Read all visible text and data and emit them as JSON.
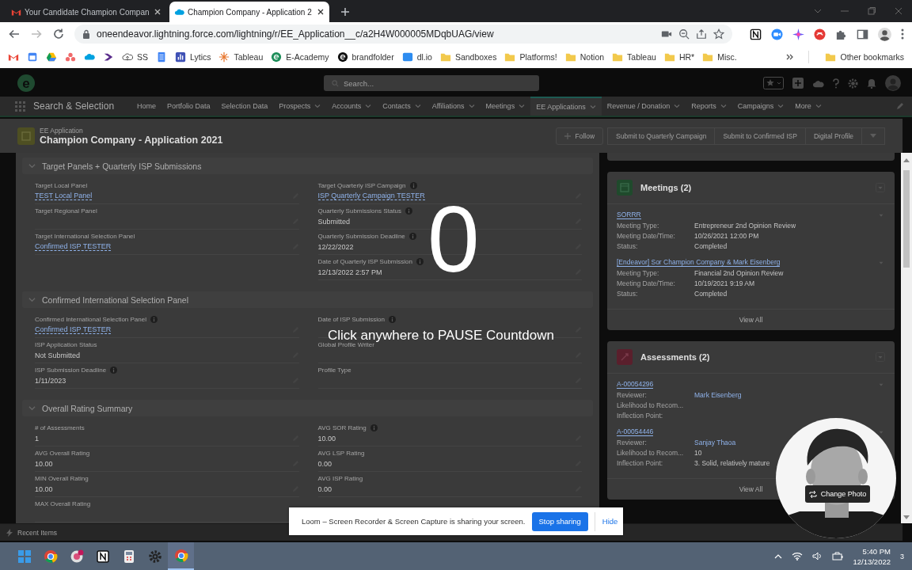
{
  "browser": {
    "tabs": [
      {
        "kind": "mail",
        "title": "Your Candidate Champion Compan",
        "selected": false
      },
      {
        "kind": "cloud",
        "title": "Champion Company - Application 2",
        "selected": true
      }
    ],
    "url": "oneendeavor.lightning.force.com/lightning/r/EE_Application__c/a2H4W000005MDqbUAG/view",
    "bookmarks": [
      {
        "kind": "mail"
      },
      {
        "kind": "calendar"
      },
      {
        "kind": "drive"
      },
      {
        "kind": "dots"
      },
      {
        "kind": "cloud"
      },
      {
        "kind": "chevron"
      },
      {
        "kind": "upload",
        "label": "SS"
      },
      {
        "kind": "doc"
      },
      {
        "kind": "chart",
        "label": "Lytics"
      },
      {
        "kind": "tableau",
        "label": "Tableau"
      },
      {
        "kind": "ecircle",
        "label": "E-Academy"
      },
      {
        "kind": "darkcircle",
        "label": "brandfolder"
      },
      {
        "kind": "square",
        "label": "dl.io"
      },
      {
        "kind": "folder",
        "label": "Sandboxes"
      },
      {
        "kind": "folder",
        "label": "Platforms!"
      },
      {
        "kind": "folder",
        "label": "Notion"
      },
      {
        "kind": "folder",
        "label": "Tableau"
      },
      {
        "kind": "folder",
        "label": "HR*"
      },
      {
        "kind": "folder",
        "label": "Misc."
      }
    ],
    "other_bookmarks": "Other bookmarks"
  },
  "app": {
    "logo_text": "e",
    "search": {
      "placeholder": "Search..."
    },
    "name": "Search & Selection",
    "nav": [
      {
        "label": "Home",
        "dropdown": false,
        "selected": false
      },
      {
        "label": "Portfolio Data",
        "dropdown": false,
        "selected": false
      },
      {
        "label": "Selection Data",
        "dropdown": false,
        "selected": false
      },
      {
        "label": "Prospects",
        "dropdown": true,
        "selected": false
      },
      {
        "label": "Accounts",
        "dropdown": true,
        "selected": false
      },
      {
        "label": "Contacts",
        "dropdown": true,
        "selected": false
      },
      {
        "label": "Affiliations",
        "dropdown": true,
        "selected": false
      },
      {
        "label": "Meetings",
        "dropdown": true,
        "selected": false
      },
      {
        "label": "EE Applications",
        "dropdown": true,
        "selected": true
      },
      {
        "label": "Revenue / Donation",
        "dropdown": true,
        "selected": false
      },
      {
        "label": "Reports",
        "dropdown": true,
        "selected": false
      },
      {
        "label": "Campaigns",
        "dropdown": true,
        "selected": false
      },
      {
        "label": "More",
        "dropdown": true,
        "selected": false
      }
    ]
  },
  "record": {
    "object": "EE Application",
    "title": "Champion Company - Application 2021",
    "actions": [
      {
        "kind": "follow",
        "label": "Follow"
      },
      {
        "kind": "plain",
        "label": "Submit to Quarterly Campaign"
      },
      {
        "kind": "plain",
        "label": "Submit to Confirmed ISP"
      },
      {
        "kind": "plain",
        "label": "Digital Profile"
      },
      {
        "kind": "menu"
      }
    ]
  },
  "sections": [
    {
      "title": "Target Panels + Quarterly ISP Submissions",
      "expanded": true,
      "left": [
        {
          "label": "Target Local Panel",
          "value": "TEST Local Panel",
          "link": true,
          "info": false
        },
        {
          "label": "Target Regional Panel",
          "info": false
        },
        {
          "label": "Target International Selection Panel",
          "value": "Confirmed ISP TESTER",
          "link": true,
          "info": false
        }
      ],
      "right": [
        {
          "label": "Target Quarterly ISP Campaign",
          "value": "ISP Quarterly Campaign TESTER",
          "link": true,
          "info": true
        },
        {
          "label": "Quarterly Submissions Status",
          "value": "Submitted",
          "link": false,
          "info": true
        },
        {
          "label": "Quarterly Submission Deadline",
          "value": "12/22/2022",
          "link": false,
          "info": true
        },
        {
          "label": "Date of Quarterly ISP Submission",
          "value": "12/13/2022 2:57 PM",
          "link": false,
          "info": true
        }
      ]
    },
    {
      "title": "Confirmed International Selection Panel",
      "expanded": true,
      "left": [
        {
          "label": "Confirmed International Selection Panel",
          "value": "Confirmed ISP TESTER",
          "link": true,
          "info": true
        },
        {
          "label": "ISP Application Status",
          "value": "Not Submitted",
          "link": false,
          "info": false
        },
        {
          "label": "ISP Submission Deadline",
          "value": "1/11/2023",
          "link": false,
          "info": true
        }
      ],
      "right": [
        {
          "label": "Date of ISP Submission",
          "info": true
        },
        {
          "label": "Global Profile Writer",
          "info": false
        },
        {
          "label": "Profile Type",
          "info": false
        }
      ]
    },
    {
      "title": "Overall Rating Summary",
      "expanded": true,
      "left": [
        {
          "label": "# of Assessments",
          "value": "1",
          "link": false,
          "info": false
        },
        {
          "label": "AVG Overall Rating",
          "value": "10.00",
          "link": false,
          "info": false
        },
        {
          "label": "MIN Overall Rating",
          "value": "10.00",
          "link": false,
          "info": false
        },
        {
          "label": "MAX Overall Rating",
          "info": false
        }
      ],
      "right": [
        {
          "label": "AVG SOR Rating",
          "value": "10.00",
          "link": false,
          "info": true
        },
        {
          "label": "AVG LSP Rating",
          "value": "0.00",
          "link": false,
          "info": false
        },
        {
          "label": "AVG ISP Rating",
          "value": "0.00",
          "link": false,
          "info": false
        }
      ]
    }
  ],
  "related": [
    {
      "kind": "meetings",
      "title": "Meetings (2)",
      "footer": "View All",
      "items": [
        {
          "title": "SORRR",
          "fields": [
            {
              "label": "Meeting Type:",
              "value": "Entrepreneur 2nd Opinion Review",
              "link": false
            },
            {
              "label": "Meeting Date/Time:",
              "value": "10/26/2021 12:00 PM",
              "link": false
            },
            {
              "label": "Status:",
              "value": "Completed",
              "link": false
            }
          ]
        },
        {
          "title": "[Endeavor] Sor Champion Company & Mark Eisenberg",
          "fields": [
            {
              "label": "Meeting Type:",
              "value": "Financial 2nd Opinion Review",
              "link": false
            },
            {
              "label": "Meeting Date/Time:",
              "value": "10/19/2021 9:19 AM",
              "link": false
            },
            {
              "label": "Status:",
              "value": "Completed",
              "link": false
            }
          ]
        }
      ]
    },
    {
      "kind": "assessments",
      "title": "Assessments (2)",
      "footer": "View All",
      "items": [
        {
          "title": "A-00054296",
          "fields": [
            {
              "label": "Reviewer:",
              "value": "Mark Eisenberg",
              "link": true
            },
            {
              "label": "Likelihood to Recom..."
            },
            {
              "label": "Inflection Point:"
            }
          ]
        },
        {
          "title": "A-00054446",
          "fields": [
            {
              "label": "Reviewer:",
              "value": "Sanjay Thaoa",
              "link": true
            },
            {
              "label": "Likelihood to Recom...",
              "value": "10",
              "link": false
            },
            {
              "label": "Inflection Point:",
              "value": "3. Solid, relatively mature",
              "link": false
            }
          ]
        }
      ]
    }
  ],
  "recent_items": "Recent Items",
  "loom": {
    "countdown": "0",
    "hint": "Click anywhere to PAUSE Countdown",
    "share_message": "Loom – Screen Recorder & Screen Capture is sharing your screen.",
    "stop": "Stop sharing",
    "hide": "Hide",
    "change_photo": "Change Photo"
  },
  "taskbar": {
    "apps": [
      {
        "kind": "windows",
        "selected": false
      },
      {
        "kind": "chrome",
        "selected": false
      },
      {
        "kind": "badge",
        "selected": false
      },
      {
        "kind": "notion",
        "selected": false
      },
      {
        "kind": "calc",
        "selected": false
      },
      {
        "kind": "gear",
        "selected": false
      },
      {
        "kind": "chrome",
        "selected": true
      }
    ],
    "time": "5:40 PM",
    "date": "12/13/2022",
    "notifications": "3"
  }
}
